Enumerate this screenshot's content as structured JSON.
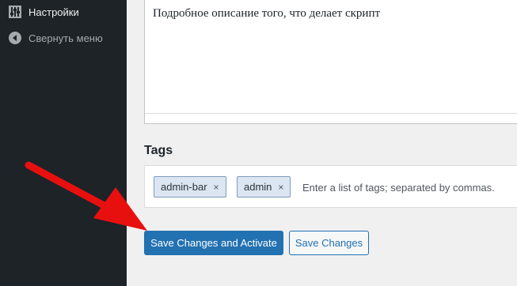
{
  "sidebar": {
    "items": [
      {
        "label": "Настройки",
        "icon": "settings-sliders-icon"
      },
      {
        "label": "Свернуть меню",
        "icon": "collapse-arrow-icon"
      }
    ]
  },
  "description": {
    "text": "Подробное описание того, что делает скрипт"
  },
  "tags": {
    "heading": "Tags",
    "chips": [
      {
        "label": "admin-bar",
        "remove": "×"
      },
      {
        "label": "admin",
        "remove": "×"
      }
    ],
    "placeholder": "Enter a list of tags; separated by commas."
  },
  "actions": {
    "primary_label": "Save Changes and Activate",
    "secondary_label": "Save Changes"
  },
  "colors": {
    "sidebar_bg": "#1d2327",
    "accent": "#2271b1",
    "annotation_arrow": "#e8100f"
  }
}
